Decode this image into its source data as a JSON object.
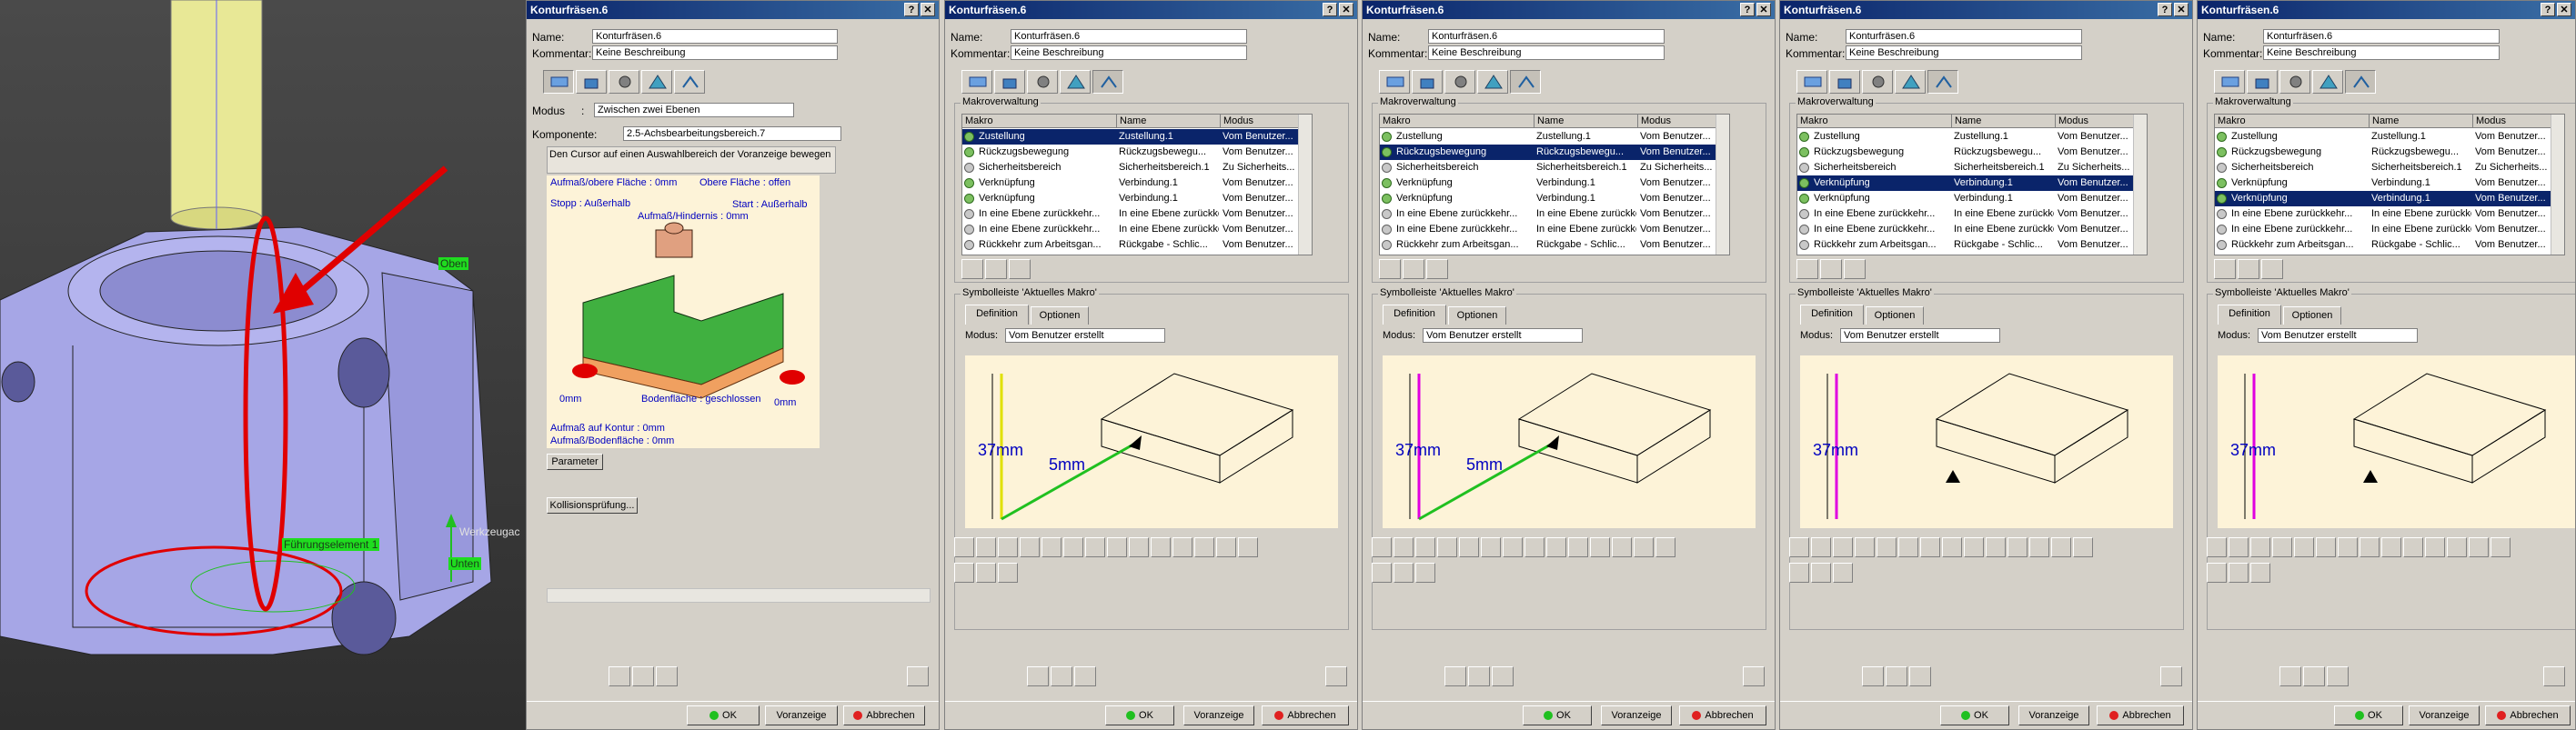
{
  "viewport": {
    "tags": {
      "top": "Oben",
      "bottom": "Unten",
      "tool_axis": "Werkzeugac",
      "guide": "Führungselement 1"
    }
  },
  "colors": {
    "titlebar": "#0a246a",
    "selection": "#0a246a",
    "annotation": "#e00000",
    "sketch_bg": "#fdf3d8",
    "tag_green": "#1fdc1f"
  },
  "common": {
    "title": "Konturfräsen.6",
    "name_label": "Name:",
    "name_value": "Konturfräsen.6",
    "comment_label": "Kommentar:",
    "comment_value": "Keine Beschreibung",
    "help_btn": "?",
    "close_btn": "✕",
    "ok": "OK",
    "preview": "Voranzeige",
    "cancel": "Abbrechen"
  },
  "geometry_panel": {
    "modus_label": "Modus",
    "modus_colon": ":",
    "modus_value": "Zwischen zwei Ebenen",
    "component_label": "Komponente:",
    "component_value": "2.5-Achsbearbeitungsbereich.7",
    "hint": "Den Cursor auf einen Auswahlbereich der Voranzeige bewegen",
    "labels": {
      "upper_offset": "Aufmaß/obere Fläche : 0mm",
      "upper_surface": "Obere Fläche : offen",
      "stop": "Stopp : Außerhalb",
      "start": "Start : Außerhalb",
      "obstacle": "Aufmaß/Hindernis : 0mm",
      "left_mm": "0mm",
      "bottom_surface": "Bodenfläche : geschlossen",
      "right_mm": "0mm",
      "contour_offset": "Aufmaß auf Kontur : 0mm",
      "bottom_offset": "Aufmaß/Bodenfläche : 0mm"
    },
    "param_btn": "Parameter",
    "collision_btn": "Kollisionsprüfung..."
  },
  "macro_panel": {
    "group_label": "Makroverwaltung",
    "columns": [
      "Makro",
      "Name",
      "Modus"
    ],
    "rows": [
      {
        "makro": "Zustellung",
        "name": "Zustellung.1",
        "modus": "Vom Benutzer...",
        "icon": "green"
      },
      {
        "makro": "Rückzugsbewegung",
        "name": "Rückzugsbewegu...",
        "modus": "Vom Benutzer...",
        "icon": "green"
      },
      {
        "makro": "Sicherheitsbereich",
        "name": "Sicherheitsbereich.1",
        "modus": "Zu Sicherheits...",
        "icon": "grey"
      },
      {
        "makro": "Verknüpfung",
        "name": "Verbindung.1",
        "modus": "Vom Benutzer...",
        "icon": "green"
      },
      {
        "makro": "Verknüpfung",
        "name": "Verbindung.1",
        "modus": "Vom Benutzer...",
        "icon": "green"
      },
      {
        "makro": "In eine Ebene zurückkehr...",
        "name": "In eine Ebene zurückkehr...",
        "modus": "Vom Benutzer...",
        "icon": "grey"
      },
      {
        "makro": "In eine Ebene zurückkehr...",
        "name": "In eine Ebene zurückkehr...",
        "modus": "Vom Benutzer...",
        "icon": "grey"
      },
      {
        "makro": "Rückkehr zum Arbeitsgan...",
        "name": "Rückgabe - Schlic...",
        "modus": "Vom Benutzer...",
        "icon": "grey"
      }
    ],
    "toolbar_label": "Symbolleiste 'Aktuelles Makro'",
    "tab_definition": "Definition",
    "tab_options": "Optionen",
    "modus_label": "Modus:",
    "modus_value": "Vom Benutzer erstellt"
  },
  "panels": [
    {
      "selected": 0,
      "dim1": "37mm",
      "dim2": "5mm",
      "color": "#e0e000"
    },
    {
      "selected": 1,
      "dim1": "37mm",
      "dim2": "5mm",
      "color": "#e000e0"
    },
    {
      "selected": 3,
      "dim1": "37mm",
      "dim2": "",
      "color": "#e000e0"
    },
    {
      "selected": 4,
      "dim1": "37mm",
      "dim2": "",
      "color": "#e000e0"
    }
  ]
}
